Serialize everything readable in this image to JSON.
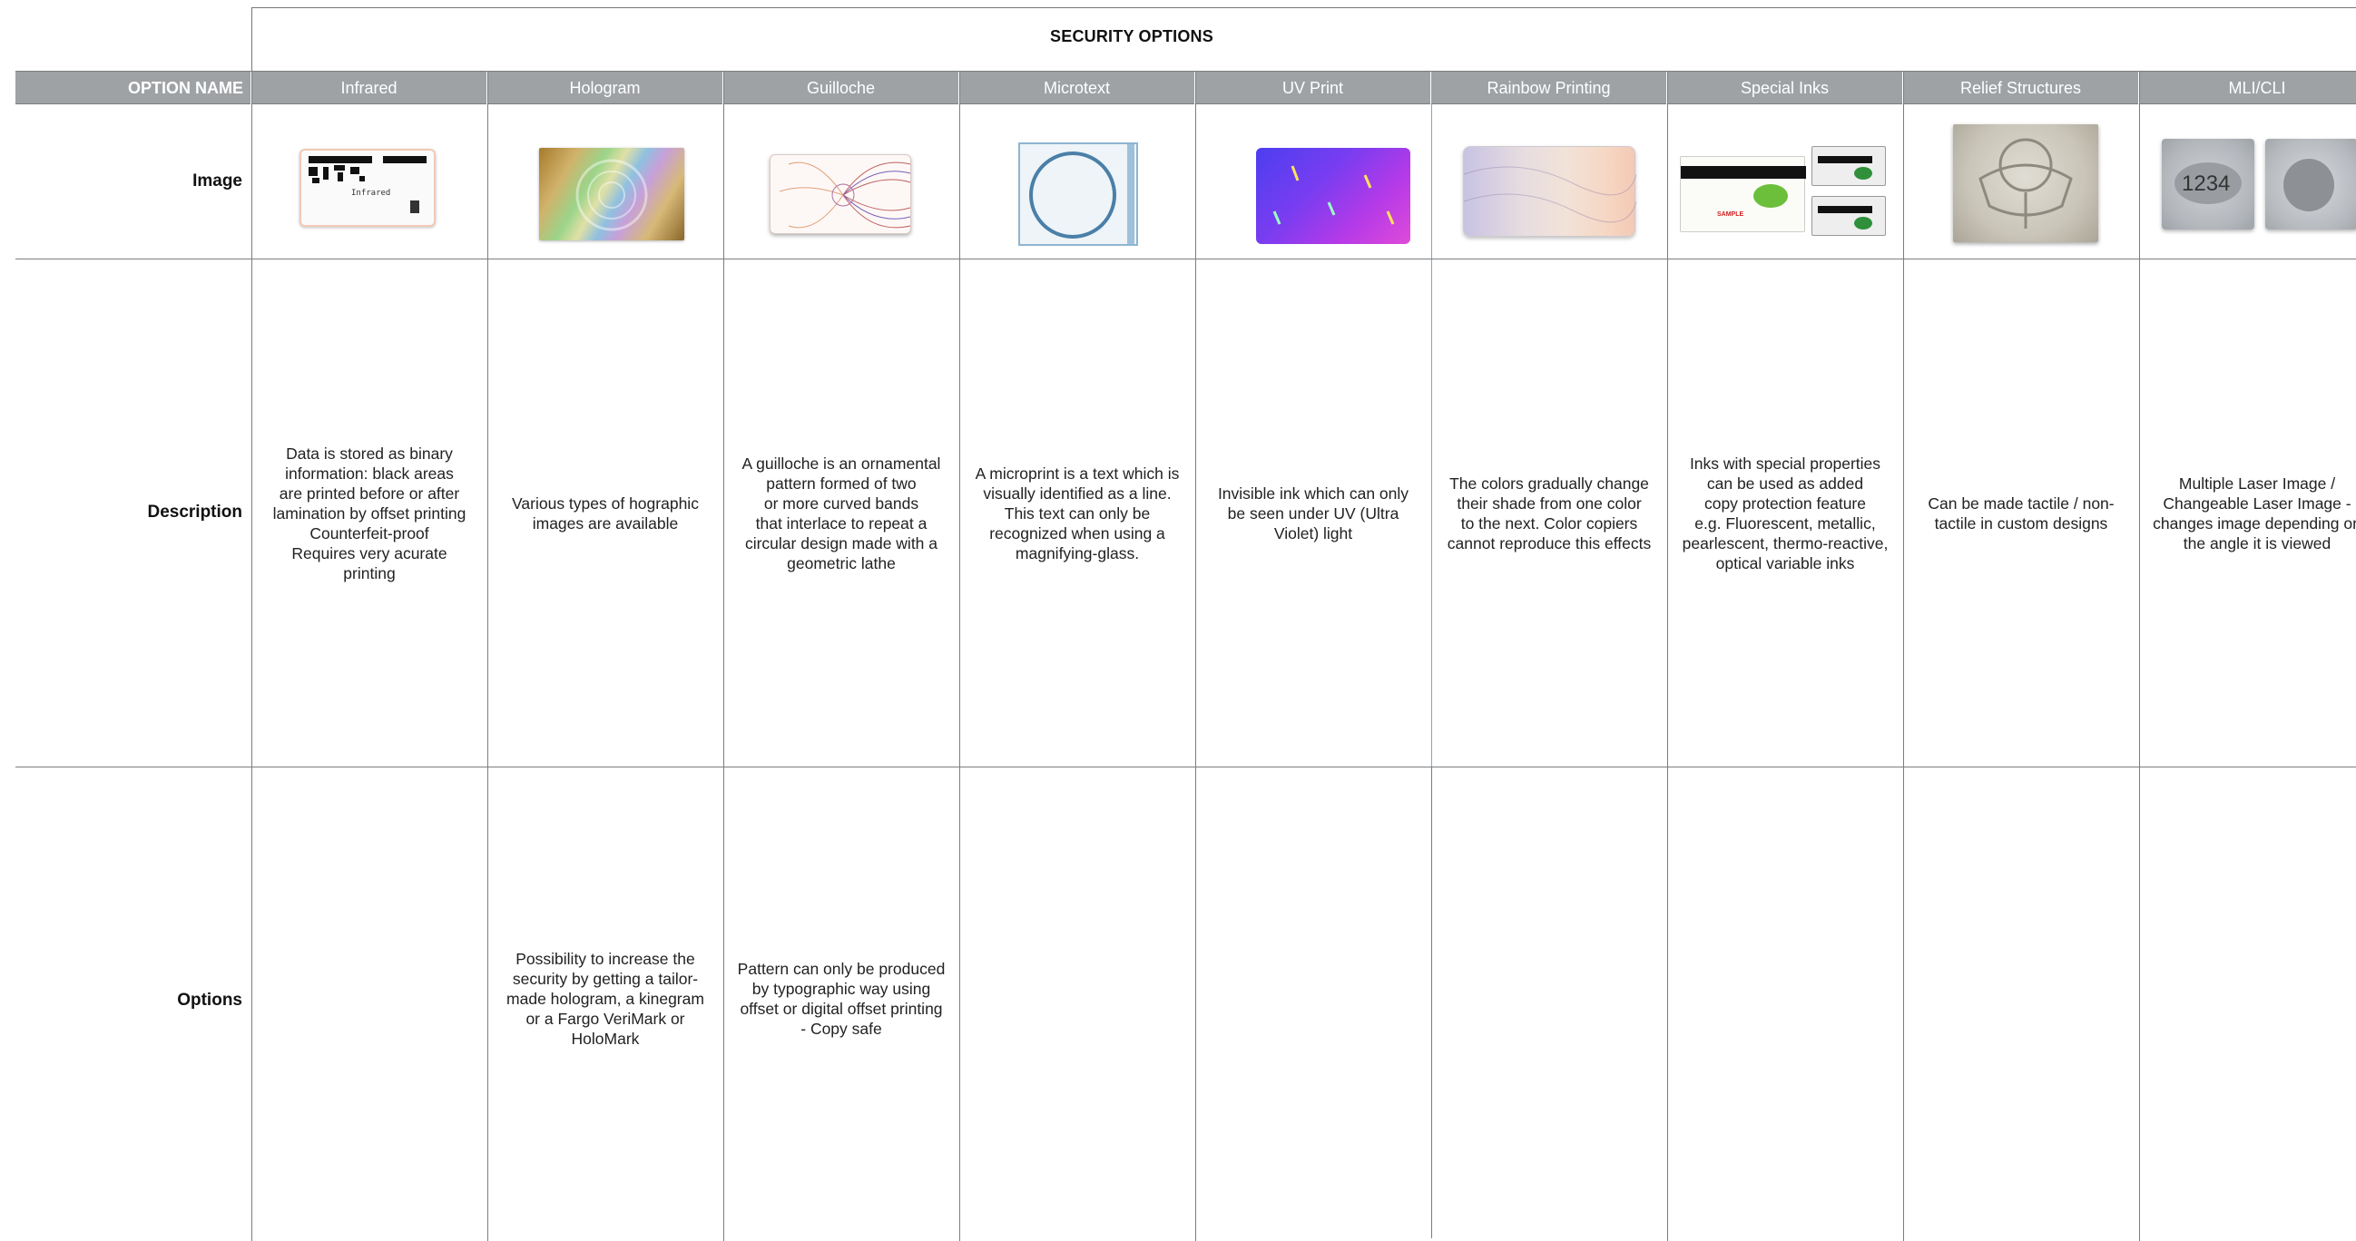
{
  "table": {
    "title": "SECURITY OPTIONS",
    "header_label": "OPTION NAME",
    "row_labels": {
      "image": "Image",
      "description": "Description",
      "options": "Options"
    },
    "columns": [
      {
        "name": "Infrared",
        "image_icon": "infrared-card-thumbnail",
        "image_text": "Infrared",
        "description": "Data is stored as binary\ninformation: black areas\nare printed before or after\nlamination by offset printing\nCounterfeit-proof\nRequires very acurate\nprinting",
        "options": ""
      },
      {
        "name": "Hologram",
        "image_icon": "hologram-card-thumbnail",
        "description": "Various types of hographic\nimages are available",
        "options": "Possibility to increase the\nsecurity by getting a tailor-\nmade hologram, a kinegram\nor a Fargo VeriMark or\nHoloMark"
      },
      {
        "name": "Guilloche",
        "image_icon": "guilloche-card-thumbnail",
        "description": "A guilloche is an ornamental\npattern formed of two\nor more curved bands\nthat interlace to repeat a\ncircular design made with a\ngeometric lathe",
        "options": "Pattern can only be produced\nby typographic way using\noffset or digital offset printing\n- Copy safe"
      },
      {
        "name": "Microtext",
        "image_icon": "microtext-card-thumbnail",
        "description": "A microprint is a text which is\nvisually identified as a line.\nThis text can only be\nrecognized when using a\nmagnifying-glass.",
        "options": ""
      },
      {
        "name": "UV Print",
        "image_icon": "uv-print-card-thumbnail",
        "description": "Invisible ink which can only\nbe seen under UV (Ultra\nViolet) light",
        "options": ""
      },
      {
        "name": "Rainbow Printing",
        "image_icon": "rainbow-printing-card-thumbnail",
        "description": "The colors gradually change\ntheir shade from one color\nto the next. Color copiers\ncannot reproduce this effects",
        "options": ""
      },
      {
        "name": "Special Inks",
        "image_icon": "special-inks-card-thumbnail",
        "image_text": "SAMPLE",
        "description": "Inks with special properties\ncan be used as added\ncopy protection feature\ne.g. Fluorescent, metallic,\npearlescent, thermo-reactive,\noptical variable inks",
        "options": ""
      },
      {
        "name": "Relief Structures",
        "image_icon": "relief-seal-thumbnail",
        "description": "Can be made tactile / non-\ntactile in custom designs",
        "options": ""
      },
      {
        "name": "MLI/CLI",
        "image_icon": "mli-cli-card-thumbnail",
        "image_text": "1234",
        "description": "Multiple Laser Image /\nChangeable Laser Image -\nchanges image depending on\nthe angle it is viewed",
        "options": ""
      }
    ]
  },
  "colors": {
    "header_bg": "#9fa2a5",
    "header_text": "#ffffff",
    "grid_line": "#7a7d80"
  }
}
